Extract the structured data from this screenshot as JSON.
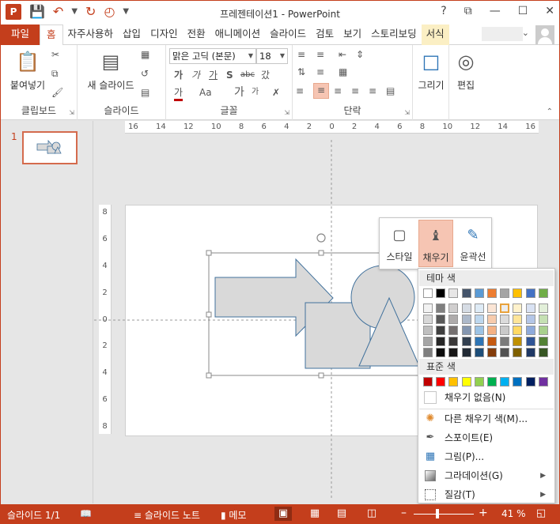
{
  "app": {
    "title": "프레젠테이션1 - PowerPoint",
    "logo": "P",
    "qat": {
      "save_icon": "save-icon",
      "undo_icon": "undo-icon",
      "redo_icon": "redo-icon",
      "start_icon": "slideshow-from-start-icon",
      "customize_icon": "customize-qat-icon"
    },
    "window_controls": [
      "?",
      "⧉",
      "—",
      "☐",
      "✕"
    ]
  },
  "tabs": [
    {
      "label": "파일",
      "kind": "file"
    },
    {
      "label": "홈",
      "kind": "active"
    },
    {
      "label": "자주사용하",
      "kind": "normal"
    },
    {
      "label": "삽입",
      "kind": "normal"
    },
    {
      "label": "디자인",
      "kind": "normal"
    },
    {
      "label": "전환",
      "kind": "normal"
    },
    {
      "label": "애니메이션",
      "kind": "normal"
    },
    {
      "label": "슬라이드",
      "kind": "normal"
    },
    {
      "label": "검토",
      "kind": "normal"
    },
    {
      "label": "보기",
      "kind": "normal"
    },
    {
      "label": "스토리보딩",
      "kind": "normal"
    },
    {
      "label": "서식",
      "kind": "contextual"
    }
  ],
  "ribbon": {
    "clipboard": {
      "label": "클립보드",
      "paste": "붙여넣기"
    },
    "slides": {
      "label": "슬라이드",
      "new_slide": "새 슬라이드"
    },
    "font": {
      "label": "글꼴",
      "font_name": "맑은 고딕 (본문)",
      "font_size": "18",
      "bold": "가",
      "italic": "가",
      "underline": "가",
      "shadow": "S",
      "strike": "abc",
      "spacing": "갔",
      "font_color": "가",
      "case": "Aa",
      "grow": "가",
      "shrink": "가"
    },
    "paragraph": {
      "label": "단락"
    },
    "drawing": {
      "label": "그리기"
    },
    "editing": {
      "label": "편집"
    }
  },
  "thumbnail": {
    "number": "1"
  },
  "rulers": {
    "h_ticks": [
      "16",
      "14",
      "12",
      "10",
      "8",
      "6",
      "4",
      "2",
      "0",
      "2",
      "4",
      "6",
      "8",
      "10",
      "12",
      "14",
      "16"
    ],
    "v_ticks": [
      "8",
      "6",
      "4",
      "2",
      "0",
      "2",
      "4",
      "6",
      "8"
    ]
  },
  "mini_toolbar": {
    "style": "스타일",
    "fill": "채우기",
    "outline": "윤곽선"
  },
  "fill_menu": {
    "theme_title": "테마 색",
    "theme_top": [
      "#ffffff",
      "#000000",
      "#e7e6e6",
      "#44546a",
      "#5b9bd5",
      "#ed7d31",
      "#a5a5a5",
      "#ffc000",
      "#4472c4",
      "#70ad47"
    ],
    "theme_shades": [
      [
        "#f2f2f2",
        "#7f7f7f",
        "#d0cece",
        "#d6dce4",
        "#deebf6",
        "#fbe5d5",
        "#ededed",
        "#fff2cc",
        "#d9e2f3",
        "#e2efd9"
      ],
      [
        "#d8d8d8",
        "#595959",
        "#aeabab",
        "#adb9ca",
        "#bdd7ee",
        "#f7cbac",
        "#dbdbdb",
        "#fee599",
        "#b4c6e7",
        "#c5e0b3"
      ],
      [
        "#bfbfbf",
        "#3f3f3f",
        "#757070",
        "#8496b0",
        "#9cc3e5",
        "#f4b183",
        "#c9c9c9",
        "#ffd965",
        "#8eaadb",
        "#a8d08d"
      ],
      [
        "#a5a5a5",
        "#262626",
        "#3a3838",
        "#323f4f",
        "#2e75b5",
        "#c55a11",
        "#7b7b7b",
        "#bf9000",
        "#2f5496",
        "#538135"
      ],
      [
        "#7f7f7f",
        "#0c0c0c",
        "#171616",
        "#222a35",
        "#1e4e79",
        "#833c0b",
        "#525252",
        "#7f6000",
        "#1f3864",
        "#375623"
      ]
    ],
    "standard_title": "표준 색",
    "standard": [
      "#c00000",
      "#ff0000",
      "#ffc000",
      "#ffff00",
      "#92d050",
      "#00b050",
      "#00b0f0",
      "#0070c0",
      "#002060",
      "#7030a0"
    ],
    "no_fill": "채우기 없음(N)",
    "more_colors": "다른 채우기 색(M)...",
    "eyedropper": "스포이트(E)",
    "picture": "그림(P)...",
    "gradient": "그라데이션(G)",
    "texture": "질감(T)"
  },
  "status": {
    "slide": "슬라이드 1/1",
    "notes": "슬라이드 노트",
    "comments": "메모",
    "zoom": "41 %",
    "zoom_level": 0.41
  },
  "colors": {
    "accent": "#c43e1c",
    "shape_fill": "#d9d9d9",
    "shape_stroke": "#41719c",
    "highlight": "#f6c5b3"
  }
}
